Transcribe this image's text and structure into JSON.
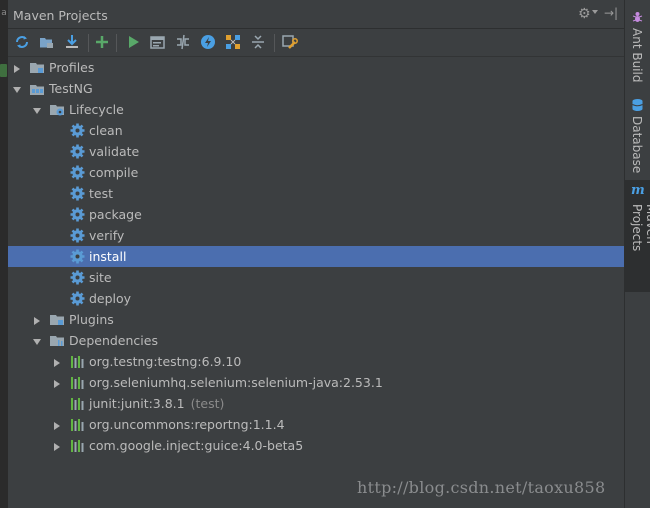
{
  "panel": {
    "title": "Maven Projects",
    "title_icons": [
      "gear-icon",
      "chevron-down-icon",
      "hide-panel-icon"
    ]
  },
  "toolbar": {
    "buttons": [
      {
        "name": "reimport-all-maven-projects-button",
        "icon": "refresh-icon",
        "color": "#4a9fe3"
      },
      {
        "name": "generate-sources-button",
        "icon": "folder-generate-icon",
        "color": "#7aa3c8"
      },
      {
        "name": "download-sources-button",
        "icon": "download-icon",
        "color": "#4a9fe3"
      },
      {
        "name": "add-maven-projects-button",
        "icon": "plus-icon",
        "color": "#59a869"
      },
      {
        "name": "run-maven-build-button",
        "icon": "run-icon",
        "color": "#59a869"
      },
      {
        "name": "execute-maven-goal-button",
        "icon": "execute-goal-icon",
        "color": "#9aa7b0"
      },
      {
        "name": "toggle-offline-mode-button",
        "icon": "offline-icon",
        "color": "#9aa7b0"
      },
      {
        "name": "skip-tests-button",
        "icon": "skip-tests-icon",
        "color": "#4a9fe3"
      },
      {
        "name": "show-dependencies-button",
        "icon": "dependencies-diagram-icon",
        "color": "#e0a030"
      },
      {
        "name": "collapse-all-button",
        "icon": "collapse-all-icon",
        "color": "#9aa7b0"
      },
      {
        "name": "maven-settings-button",
        "icon": "settings-wrench-icon",
        "color": "#e0a030"
      }
    ]
  },
  "tree": {
    "rows": [
      {
        "label": "Profiles",
        "level": 0,
        "arrow": "right",
        "icon": "folder"
      },
      {
        "label": "TestNG",
        "level": 0,
        "arrow": "down",
        "icon": "maven-project"
      },
      {
        "label": "Lifecycle",
        "level": 1,
        "arrow": "down",
        "icon": "folder-gear"
      },
      {
        "label": "clean",
        "level": 2,
        "arrow": "none",
        "icon": "gear"
      },
      {
        "label": "validate",
        "level": 2,
        "arrow": "none",
        "icon": "gear"
      },
      {
        "label": "compile",
        "level": 2,
        "arrow": "none",
        "icon": "gear"
      },
      {
        "label": "test",
        "level": 2,
        "arrow": "none",
        "icon": "gear"
      },
      {
        "label": "package",
        "level": 2,
        "arrow": "none",
        "icon": "gear"
      },
      {
        "label": "verify",
        "level": 2,
        "arrow": "none",
        "icon": "gear"
      },
      {
        "label": "install",
        "level": 2,
        "arrow": "none",
        "icon": "gear",
        "selected": true
      },
      {
        "label": "site",
        "level": 2,
        "arrow": "none",
        "icon": "gear"
      },
      {
        "label": "deploy",
        "level": 2,
        "arrow": "none",
        "icon": "gear"
      },
      {
        "label": "Plugins",
        "level": 1,
        "arrow": "right",
        "icon": "folder-plugin"
      },
      {
        "label": "Dependencies",
        "level": 1,
        "arrow": "down",
        "icon": "folder-deps"
      },
      {
        "label": "org.testng:testng:6.9.10",
        "level": 2,
        "arrow": "right",
        "icon": "library"
      },
      {
        "label": "org.seleniumhq.selenium:selenium-java:2.53.1",
        "level": 2,
        "arrow": "right",
        "icon": "library"
      },
      {
        "label": "junit:junit:3.8.1",
        "suffix": "(test)",
        "level": 2,
        "arrow": "none",
        "icon": "library"
      },
      {
        "label": "org.uncommons:reportng:1.1.4",
        "level": 2,
        "arrow": "right",
        "icon": "library"
      },
      {
        "label": "com.google.inject:guice:4.0-beta5",
        "level": 2,
        "arrow": "right",
        "icon": "library"
      }
    ]
  },
  "right_sidebar": {
    "tabs": [
      {
        "label": "Ant Build",
        "icon": "ant-icon",
        "active": false
      },
      {
        "label": "Database",
        "icon": "database-icon",
        "active": false
      },
      {
        "label": "Maven Projects",
        "icon": "maven-m-icon",
        "active": true
      }
    ]
  },
  "watermark": "http://blog.csdn.net/taoxu858",
  "colors": {
    "background": "#3c3f41",
    "selection": "#4b6eaf",
    "text": "#bbbbbb",
    "gear_icon": "#5a9bd5",
    "library_icon_green": "#62b543"
  }
}
